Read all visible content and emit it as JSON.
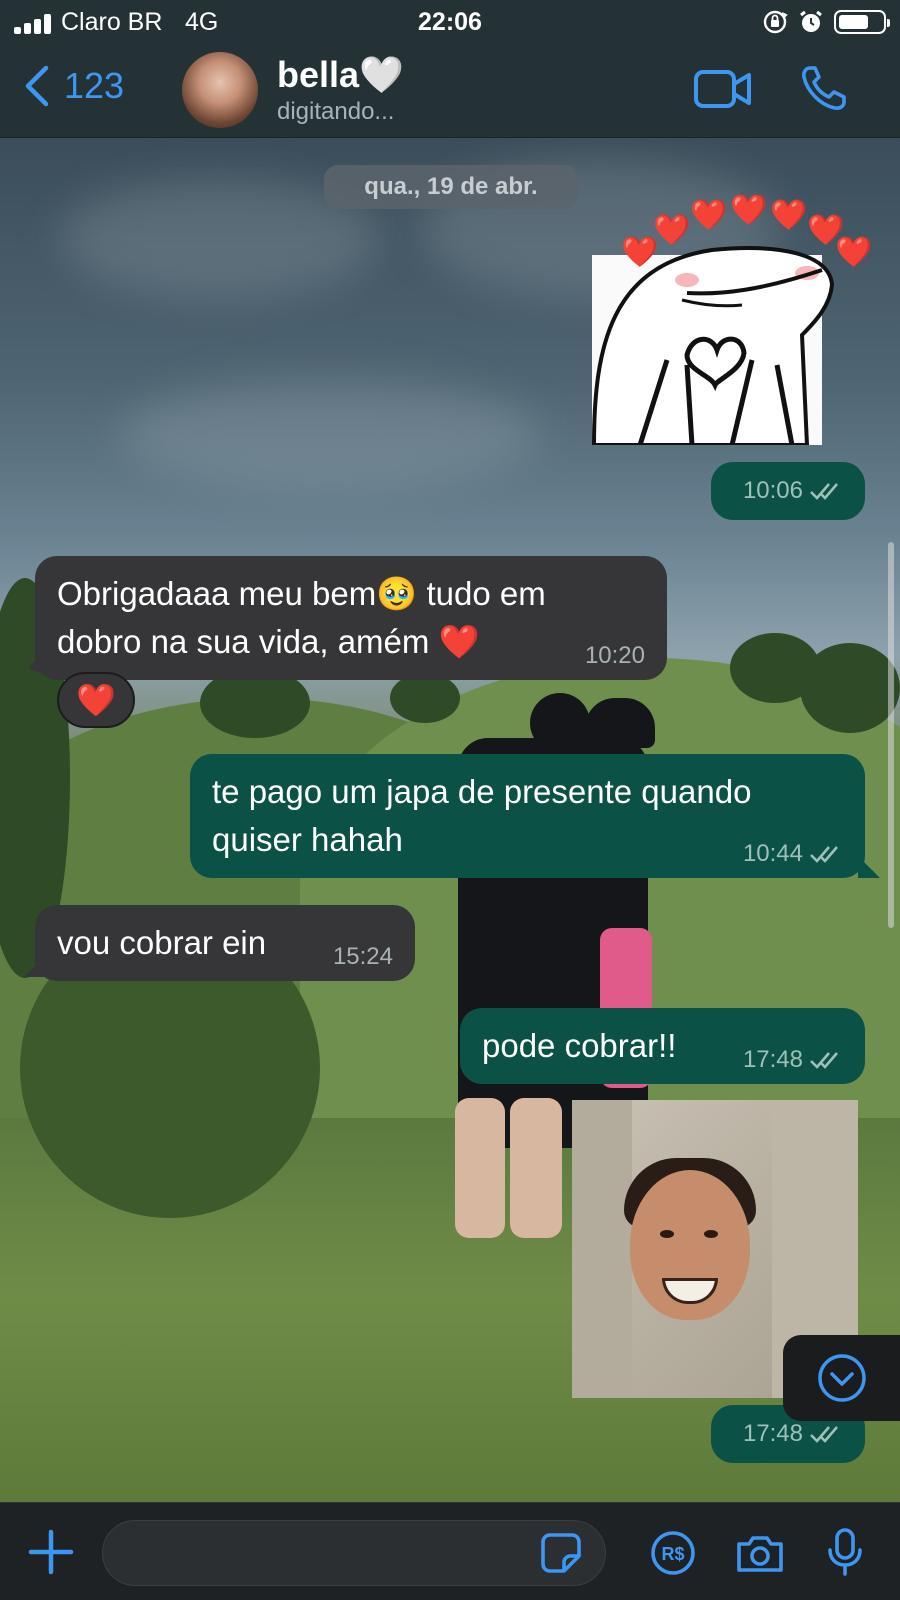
{
  "status_bar": {
    "carrier": "Claro BR",
    "network": "4G",
    "time": "22:06",
    "battery_level": 0.7
  },
  "header": {
    "back_count": "123",
    "contact_name": "bella🤍",
    "contact_status": "digitando..."
  },
  "chat": {
    "date_chip": "qua., 19 de abr.",
    "messages": [
      {
        "direction": "out",
        "type": "sticker",
        "time": "10:06",
        "read": true
      },
      {
        "direction": "in",
        "type": "text",
        "text": "Obrigadaaa meu bem🥹 tudo em dobro na sua vida, amém ❤️",
        "time": "10:20",
        "reaction": "❤️"
      },
      {
        "direction": "out",
        "type": "text",
        "text": "te pago um japa de presente quando quiser hahah",
        "time": "10:44",
        "read": true
      },
      {
        "direction": "in",
        "type": "text",
        "text": "vou cobrar ein",
        "time": "15:24"
      },
      {
        "direction": "out",
        "type": "text",
        "text": "pode cobrar!!",
        "time": "17:48",
        "read": true
      },
      {
        "direction": "out",
        "type": "sticker",
        "time": "17:48",
        "read": true
      }
    ]
  },
  "input_bar": {
    "placeholder": "",
    "value": ""
  },
  "colors": {
    "accent_blue": "#3d96f2",
    "outgoing_bubble": "#0b5146",
    "incoming_bubble": "#363638",
    "header_bg": "#243236"
  },
  "icons": {
    "signal": "signal-icon",
    "rotation_lock": "rotation-lock-icon",
    "alarm": "alarm-icon",
    "battery": "battery-icon",
    "back": "chevron-left-icon",
    "video": "video-camera-icon",
    "call": "phone-icon",
    "read_receipt": "double-check-icon",
    "scroll_down": "chevron-down-circle-icon",
    "plus": "plus-icon",
    "sticker": "sticker-icon",
    "pix": "pix-icon",
    "camera": "camera-icon",
    "mic": "microphone-icon"
  }
}
